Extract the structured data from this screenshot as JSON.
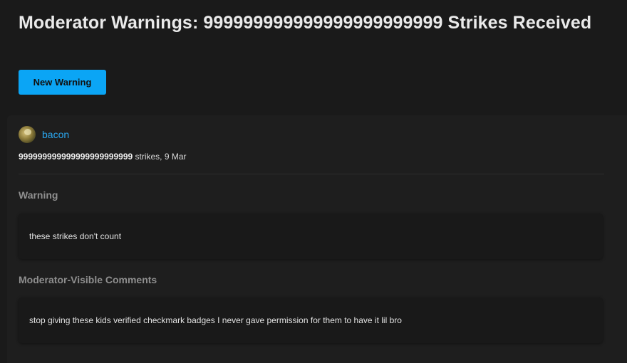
{
  "header": {
    "title": "Moderator Warnings: 999999999999999999999999 Strikes Received",
    "new_warning_label": "New Warning"
  },
  "warning": {
    "username": "bacon",
    "strike_count": "999999999999999999999999",
    "strike_suffix": " strikes, 9 Mar",
    "warning_heading": "Warning",
    "warning_text": "these strikes don't count",
    "comments_heading": "Moderator-Visible Comments",
    "comments_text": "stop giving these kids verified checkmark badges I never gave permission for them to have it lil bro"
  },
  "colors": {
    "background": "#1a1a1a",
    "accent": "#0ba5f5",
    "link": "#2aa6ee",
    "heading_muted": "#8f8f8f"
  }
}
